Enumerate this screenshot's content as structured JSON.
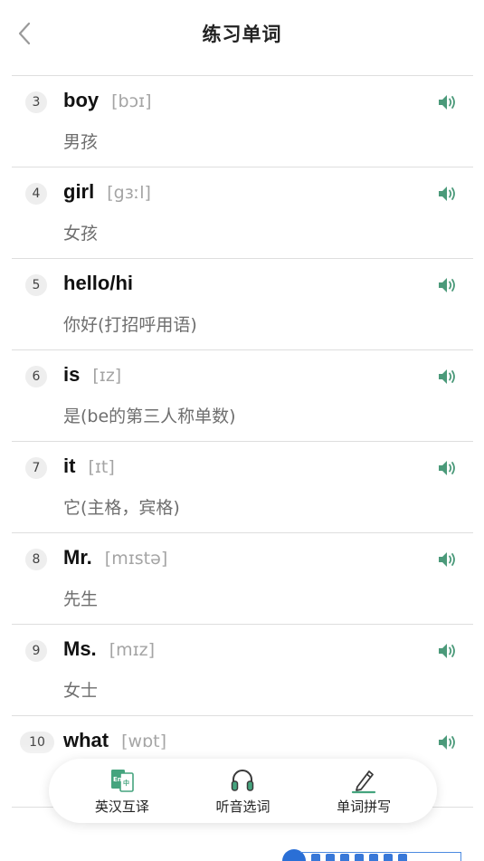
{
  "header": {
    "title": "练习单词"
  },
  "words": [
    {
      "num": "3",
      "word": "boy",
      "phonetic": "[bɔɪ]",
      "meaning": "男孩"
    },
    {
      "num": "4",
      "word": "girl",
      "phonetic": "[gɜːl]",
      "meaning": "女孩"
    },
    {
      "num": "5",
      "word": "hello/hi",
      "phonetic": "",
      "meaning": "你好(打招呼用语)"
    },
    {
      "num": "6",
      "word": "is",
      "phonetic": "[ɪz]",
      "meaning": "是(be的第三人称单数)"
    },
    {
      "num": "7",
      "word": "it",
      "phonetic": "[ɪt]",
      "meaning": "它(主格，宾格)"
    },
    {
      "num": "8",
      "word": "Mr.",
      "phonetic": "[mɪstə]",
      "meaning": "先生"
    },
    {
      "num": "9",
      "word": "Ms.",
      "phonetic": "[mɪz]",
      "meaning": "女士"
    },
    {
      "num": "10",
      "word": "what",
      "phonetic": "[wɒt]",
      "meaning": ""
    }
  ],
  "toolbar": {
    "translate_label": "英汉互译",
    "listen_label": "听音选词",
    "spell_label": "单词拼写",
    "translate_icon": "en-zh-book-icon",
    "listen_icon": "headphones-icon",
    "spell_icon": "pencil-icon"
  },
  "colors": {
    "accent": "#45a47e",
    "speaker": "#4b9a7a"
  }
}
